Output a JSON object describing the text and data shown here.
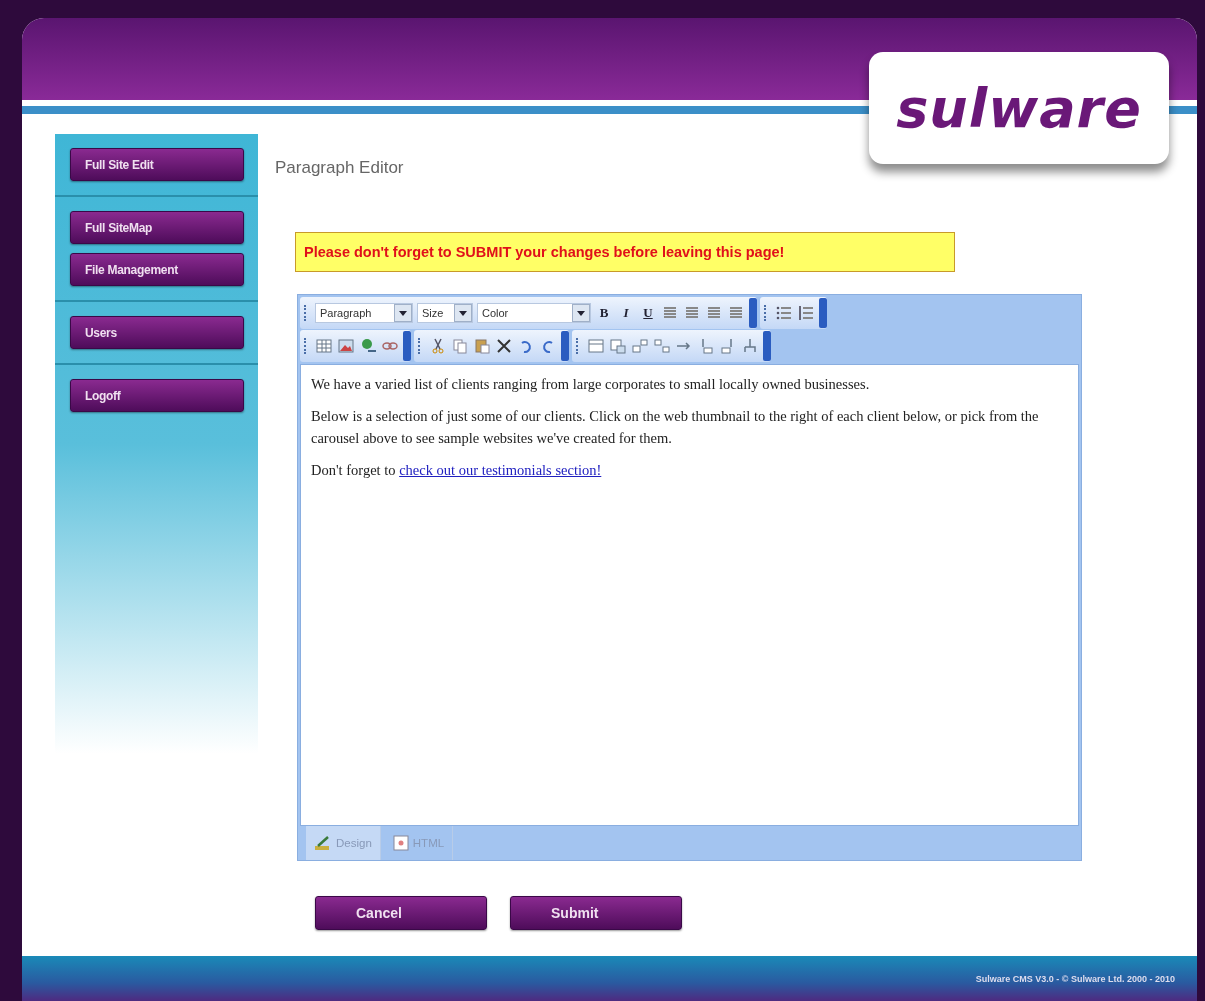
{
  "logo": {
    "text": "sulware"
  },
  "sidebar": {
    "groups": [
      [
        {
          "label": "Full Site Edit"
        }
      ],
      [
        {
          "label": "Full SiteMap"
        },
        {
          "label": "File Management"
        }
      ],
      [
        {
          "label": "Users"
        }
      ],
      [
        {
          "label": "Logoff"
        }
      ]
    ]
  },
  "page_title": "Paragraph Editor",
  "warning": "Please don't forget to SUBMIT your changes before leaving this page!",
  "toolbar": {
    "format": "Paragraph",
    "size": "Size",
    "color_label": "Color",
    "bold": "B",
    "italic": "I",
    "underline": "U"
  },
  "editor": {
    "paragraphs": [
      {
        "text": "We have a varied list of clients ranging from large corporates  to small locally owned businesses."
      },
      {
        "text": "Below is a selection of just some of our clients. Click on the web thumbnail to the right of each client below, or pick from the carousel above to see sample websites we've created for them."
      },
      {
        "text": "Don't forget to ",
        "link": "check out our testimonials section!"
      }
    ]
  },
  "tabs": [
    {
      "label": "Design",
      "selected": true
    },
    {
      "label": "HTML",
      "selected": false
    }
  ],
  "buttons": [
    {
      "label": "Cancel"
    },
    {
      "label": "Submit"
    }
  ],
  "footer": "Sulware CMS V3.0 - © Sulware Ltd. 2000 - 2010"
}
